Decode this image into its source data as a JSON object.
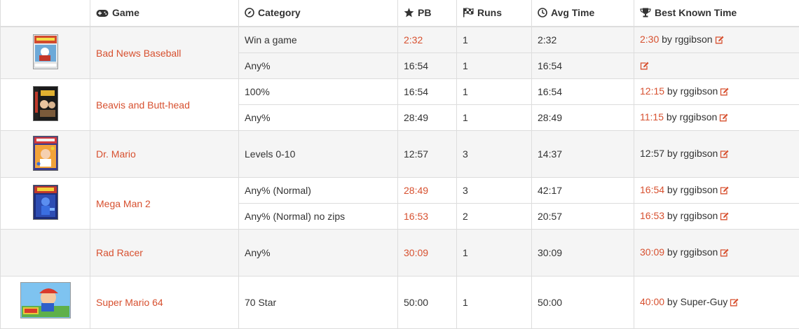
{
  "headers": {
    "game": "Game",
    "category": "Category",
    "pb": "PB",
    "runs": "Runs",
    "avg": "Avg Time",
    "best": "Best Known Time"
  },
  "games": [
    {
      "name": "Bad News Baseball",
      "cover": "bad-news-baseball-box-art",
      "rows": [
        {
          "category": "Win a game",
          "pb": "2:32",
          "pb_link": true,
          "runs": "1",
          "avg": "2:32",
          "best": "2:30",
          "best_link": true,
          "by": " by rggibson"
        },
        {
          "category": "Any%",
          "pb": "16:54",
          "pb_link": false,
          "runs": "1",
          "avg": "16:54",
          "best": "",
          "best_link": false,
          "by": ""
        }
      ]
    },
    {
      "name": "Beavis and Butt-head",
      "cover": "beavis-and-butt-head-box-art",
      "rows": [
        {
          "category": "100%",
          "pb": "16:54",
          "pb_link": false,
          "runs": "1",
          "avg": "16:54",
          "best": "12:15",
          "best_link": true,
          "by": " by rggibson"
        },
        {
          "category": "Any%",
          "pb": "28:49",
          "pb_link": false,
          "runs": "1",
          "avg": "28:49",
          "best": "11:15",
          "best_link": true,
          "by": " by rggibson"
        }
      ]
    },
    {
      "name": "Dr. Mario",
      "cover": "dr-mario-box-art",
      "rows": [
        {
          "category": "Levels 0-10",
          "pb": "12:57",
          "pb_link": false,
          "runs": "3",
          "avg": "14:37",
          "best": "12:57",
          "best_link": false,
          "by": " by rggibson"
        }
      ]
    },
    {
      "name": "Mega Man 2",
      "cover": "mega-man-2-box-art",
      "rows": [
        {
          "category": "Any% (Normal)",
          "pb": "28:49",
          "pb_link": true,
          "runs": "3",
          "avg": "42:17",
          "best": "16:54",
          "best_link": true,
          "by": " by rggibson"
        },
        {
          "category": "Any% (Normal) no zips",
          "pb": "16:53",
          "pb_link": true,
          "runs": "2",
          "avg": "20:57",
          "best": "16:53",
          "best_link": true,
          "by": " by rggibson"
        }
      ]
    },
    {
      "name": "Rad Racer",
      "cover": "",
      "rows": [
        {
          "category": "Any%",
          "pb": "30:09",
          "pb_link": true,
          "runs": "1",
          "avg": "30:09",
          "best": "30:09",
          "best_link": true,
          "by": " by rggibson"
        }
      ]
    },
    {
      "name": "Super Mario 64",
      "cover": "super-mario-64-box-art",
      "rows": [
        {
          "category": "70 Star",
          "pb": "50:00",
          "pb_link": false,
          "runs": "1",
          "avg": "50:00",
          "best": "40:00",
          "best_link": true,
          "by": " by Super-Guy"
        }
      ]
    }
  ],
  "colors": {
    "link": "#d7502f",
    "shade": "#f5f5f5",
    "border": "#dddddd"
  },
  "icons": {
    "game": "gamepad-icon",
    "category": "compass-icon",
    "pb": "star-icon",
    "runs": "flag-checkered-icon",
    "avg": "clock-icon",
    "best": "trophy-icon",
    "edit": "edit-icon"
  }
}
